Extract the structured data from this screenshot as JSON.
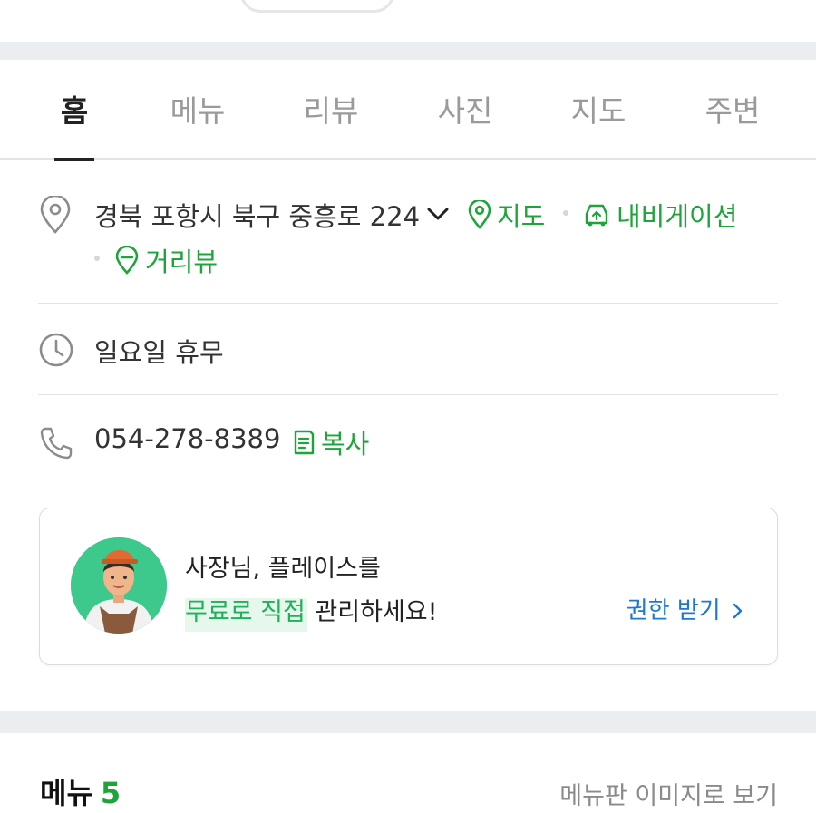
{
  "tabs": [
    {
      "label": "홈",
      "active": true
    },
    {
      "label": "메뉴",
      "active": false
    },
    {
      "label": "리뷰",
      "active": false
    },
    {
      "label": "사진",
      "active": false
    },
    {
      "label": "지도",
      "active": false
    },
    {
      "label": "주변",
      "active": false
    }
  ],
  "address": {
    "text": "경북 포항시 북구 중흥로 224",
    "icon": "location-pin-icon",
    "expand_icon": "chevron-down-icon",
    "map_label": "지도",
    "navigation_label": "내비게이션",
    "streetview_label": "거리뷰"
  },
  "hours": {
    "text": "일요일 휴무",
    "icon": "clock-icon"
  },
  "phone": {
    "number": "054-278-8389",
    "icon": "phone-icon",
    "copy_label": "복사"
  },
  "owner_banner": {
    "line1": "사장님, 플레이스를",
    "highlight": "무료로 직접",
    "line2_rest": "관리하세요!",
    "cta_label": "권한 받기",
    "cta_icon": "chevron-right-icon"
  },
  "menu_section": {
    "title": "메뉴",
    "count": "5",
    "view_board_label": "메뉴판 이미지로 보기"
  },
  "colors": {
    "accent_green": "#1da53a",
    "link_blue": "#1e78cc",
    "section_gap": "#ebeef1"
  }
}
